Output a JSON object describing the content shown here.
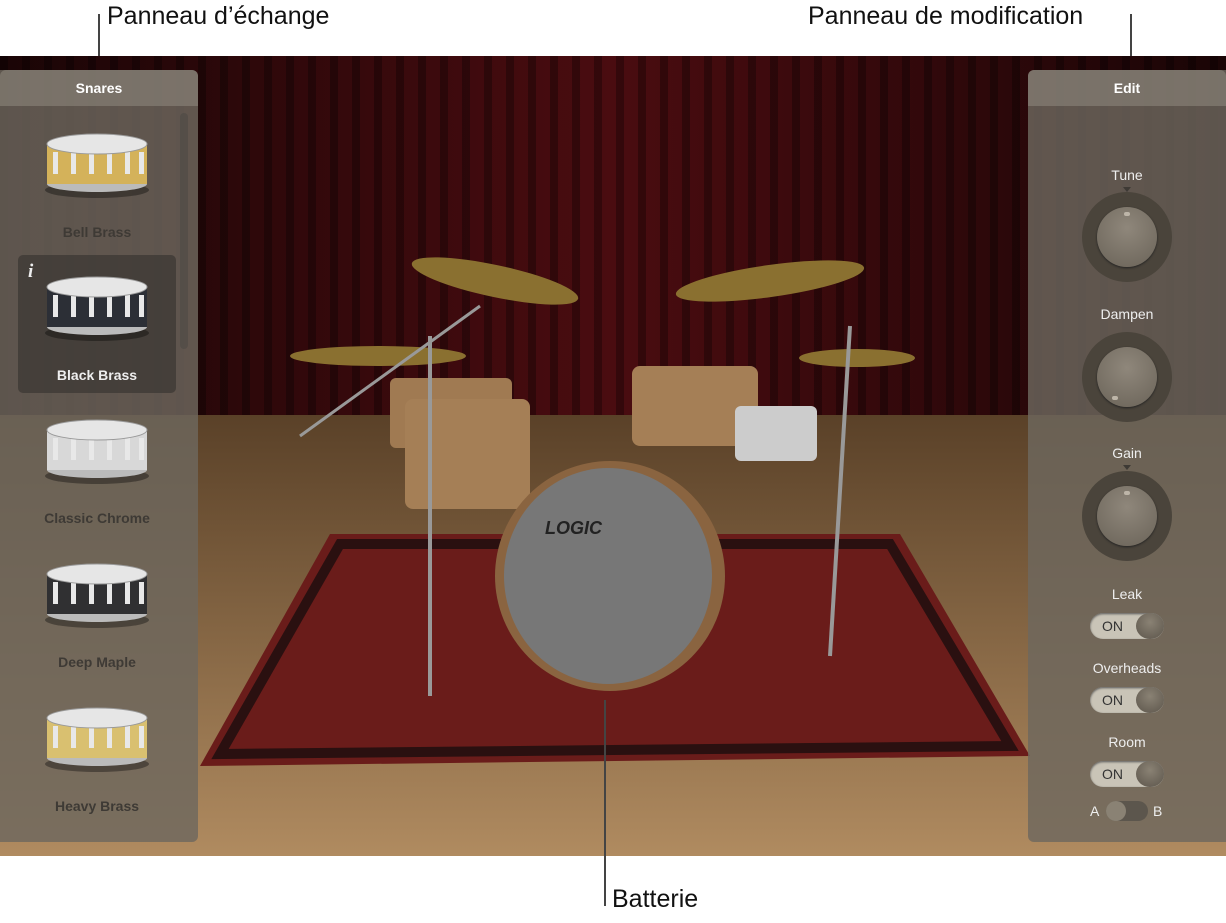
{
  "callouts": {
    "swap_panel": "Panneau d’échange",
    "edit_panel": "Panneau de modification",
    "kit": "Batterie"
  },
  "left_panel": {
    "title": "Snares",
    "items": [
      {
        "label": "Bell Brass",
        "shell": "#d4b25a",
        "selected": false
      },
      {
        "label": "Black Brass",
        "shell": "#2c2f36",
        "selected": true
      },
      {
        "label": "Classic Chrome",
        "shell": "#d8d8d8",
        "selected": false
      },
      {
        "label": "Deep Maple",
        "shell": "#303032",
        "selected": false
      },
      {
        "label": "Heavy Brass",
        "shell": "#d9c070",
        "selected": false
      }
    ],
    "info_icon": "i"
  },
  "right_panel": {
    "title": "Edit",
    "knobs": [
      {
        "label": "Tune"
      },
      {
        "label": "Dampen"
      },
      {
        "label": "Gain"
      }
    ],
    "toggles": [
      {
        "label": "Leak",
        "value": "ON"
      },
      {
        "label": "Overheads",
        "value": "ON"
      },
      {
        "label": "Room",
        "value": "ON"
      }
    ],
    "ab_switch": {
      "a": "A",
      "b": "B",
      "selected": "A"
    }
  },
  "kit": {
    "bass_drum_logo": "LOGIC"
  },
  "colors": {
    "curtain": "#3a0a0c",
    "floor": "#8a6a48",
    "rug": "#6a1c1a"
  }
}
